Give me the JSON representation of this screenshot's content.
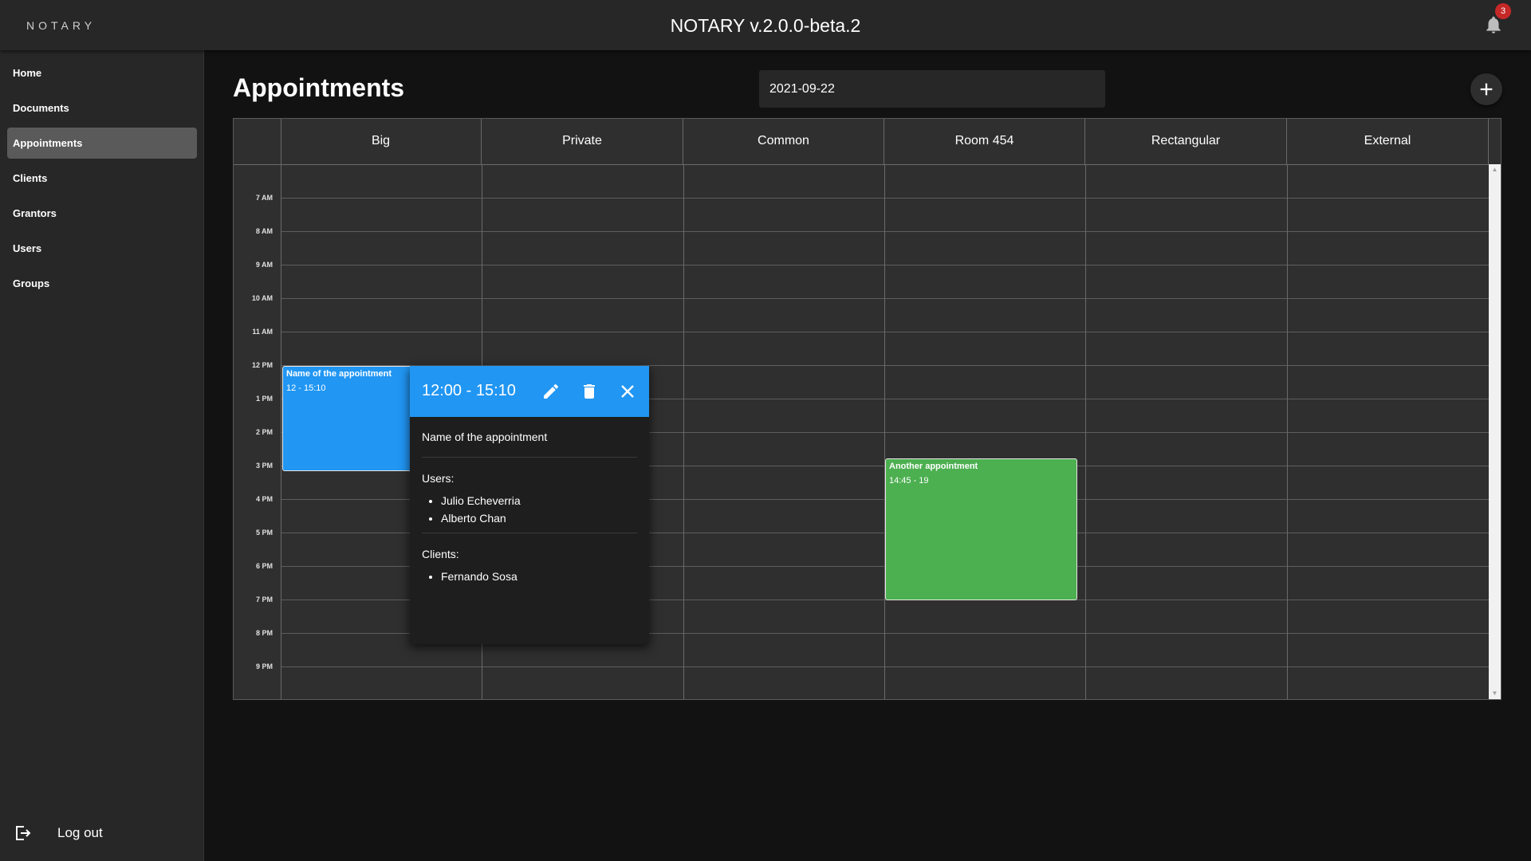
{
  "app": {
    "brand": "NOTARY",
    "title": "NOTARY v.2.0.0-beta.2",
    "notifications_count": "3"
  },
  "sidebar": {
    "items": [
      {
        "label": "Home",
        "active": false
      },
      {
        "label": "Documents",
        "active": false
      },
      {
        "label": "Appointments",
        "active": true
      },
      {
        "label": "Clients",
        "active": false
      },
      {
        "label": "Grantors",
        "active": false
      },
      {
        "label": "Users",
        "active": false
      },
      {
        "label": "Groups",
        "active": false
      }
    ],
    "logout_label": "Log out"
  },
  "main": {
    "title": "Appointments",
    "date": "2021-09-22"
  },
  "calendar": {
    "rooms": [
      "Big",
      "Private",
      "Common",
      "Room 454",
      "Rectangular",
      "External"
    ],
    "hours": [
      "7 AM",
      "8 AM",
      "9 AM",
      "10 AM",
      "11 AM",
      "12 PM",
      "1 PM",
      "2 PM",
      "3 PM",
      "4 PM",
      "5 PM",
      "6 PM",
      "7 PM",
      "8 PM",
      "9 PM"
    ],
    "events": [
      {
        "name": "Name of the appointment",
        "time": "12 - 15:10",
        "room": "Big",
        "color": "#2196f3"
      },
      {
        "name": "Another appointment",
        "time": "14:45 - 19",
        "room": "Room 454",
        "color": "#4caf50"
      }
    ]
  },
  "popover": {
    "time": "12:00 - 15:10",
    "name": "Name of the appointment",
    "users_label": "Users:",
    "users": [
      "Julio Echeverria",
      "Alberto Chan"
    ],
    "clients_label": "Clients:",
    "clients": [
      "Fernando Sosa"
    ]
  },
  "colors": {
    "accent": "#2196f3",
    "green_event": "#4caf50",
    "badge": "#c62828"
  },
  "icons": {
    "bell": "bell-icon",
    "add": "plus-icon",
    "edit": "pencil-icon",
    "delete": "trash-icon",
    "close": "close-icon",
    "logout": "logout-icon"
  }
}
